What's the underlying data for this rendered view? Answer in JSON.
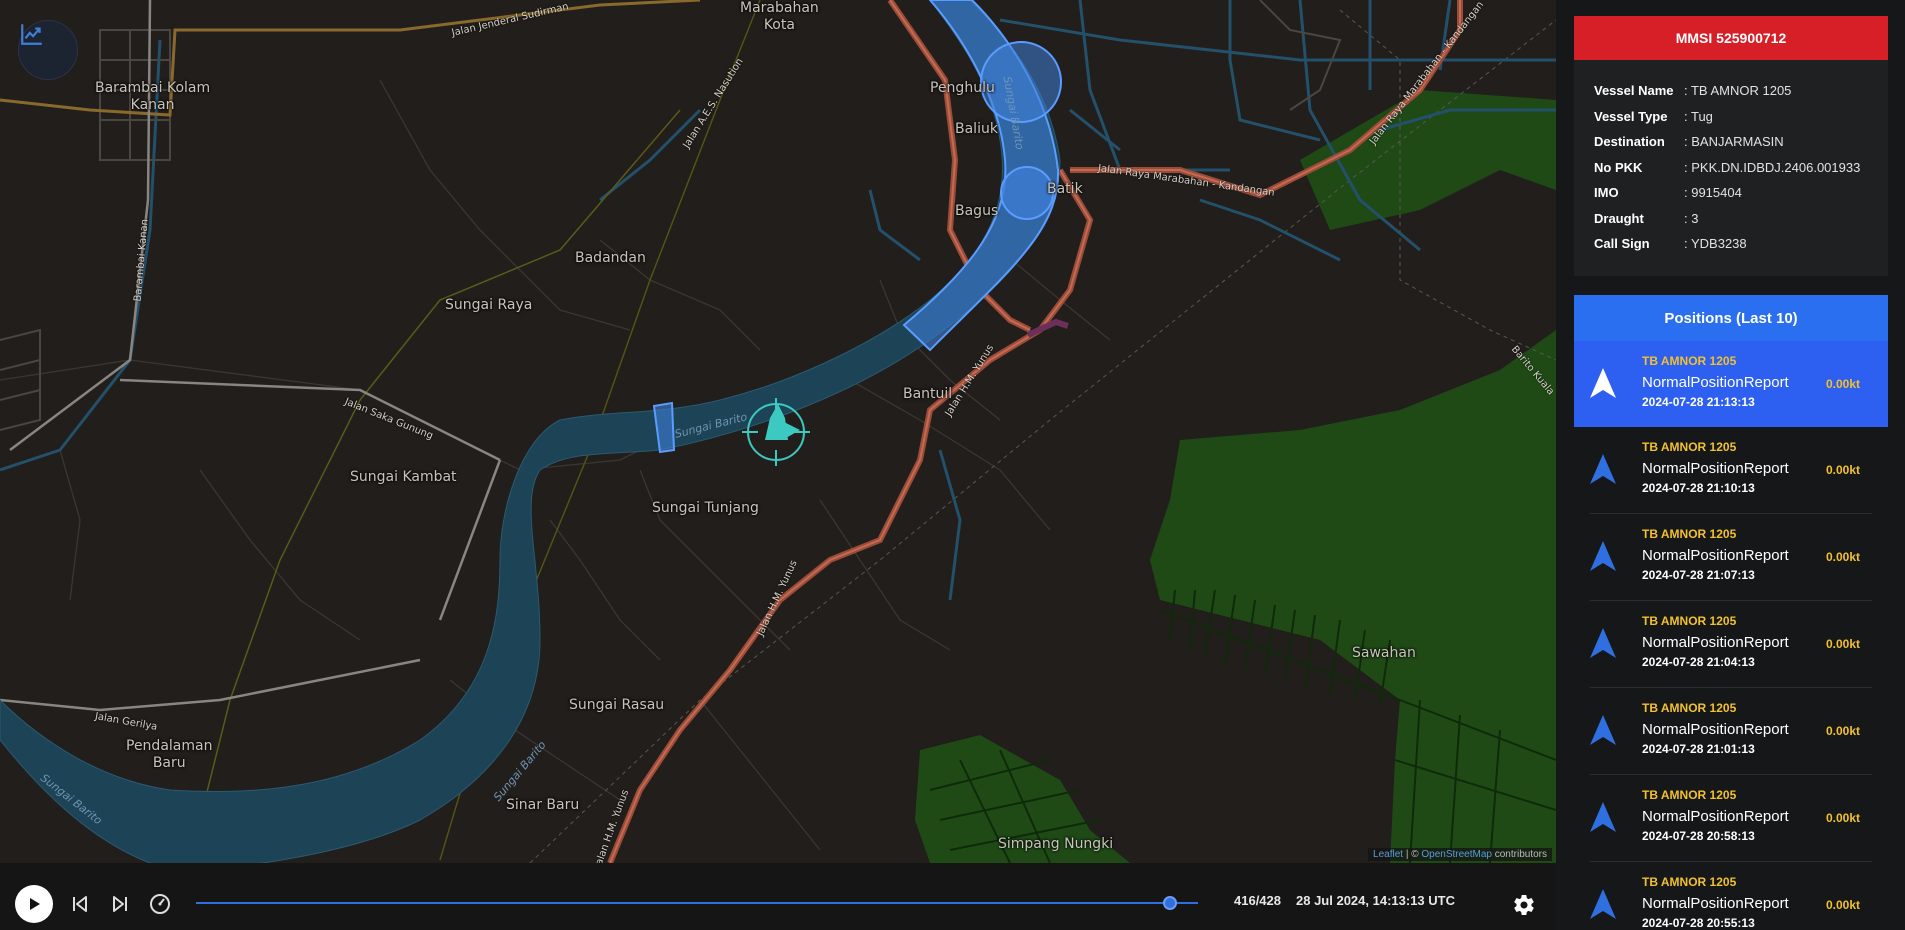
{
  "map": {
    "places": [
      {
        "id": "marabahan-kota",
        "text": "Marabahan\nKota"
      },
      {
        "id": "barambai-kolam-kanan",
        "text": "Barambai Kolam\nKanan"
      },
      {
        "id": "penghulu",
        "text": "Penghulu"
      },
      {
        "id": "baliuk",
        "text": "Baliuk"
      },
      {
        "id": "bagus",
        "text": "Bagus"
      },
      {
        "id": "batik",
        "text": "Batik"
      },
      {
        "id": "badandan",
        "text": "Badandan"
      },
      {
        "id": "sungai-raya",
        "text": "Sungai Raya"
      },
      {
        "id": "bantuil",
        "text": "Bantuil"
      },
      {
        "id": "sungai-kambat",
        "text": "Sungai Kambat"
      },
      {
        "id": "sungai-tunjang",
        "text": "Sungai Tunjang"
      },
      {
        "id": "sawahan",
        "text": "Sawahan"
      },
      {
        "id": "sungai-rasau",
        "text": "Sungai Rasau"
      },
      {
        "id": "pendalaman-baru",
        "text": "Pendalaman\nBaru"
      },
      {
        "id": "sinar-baru",
        "text": "Sinar Baru"
      },
      {
        "id": "simpang-nungki",
        "text": "Simpang Nungki"
      }
    ],
    "road_labels": {
      "jalan_sudirman": "Jalan Jenderal Sudirman",
      "jalan_nasution": "Jalan A.E.S. Nasution",
      "jalan_marabahan_1": "Jalan Raya Marabahan - Kandangan",
      "jalan_marabahan_2": "Jalan Raya Marabahan - Kandangan",
      "jalan_yunus_1": "Jalan H.M. Yunus",
      "jalan_yunus_2": "Jalan H.M. Yunus",
      "jalan_yunus_3": "Jalan H.M. Yunus",
      "jalan_saka_gunung": "Jalan Saka Gunung",
      "jalan_gerilya": "Jalan Gerilya",
      "jalan_bantil": "Barambai Kanan",
      "barito_kuala": "Barito Kuala"
    },
    "river_labels": {
      "barito_1": "Sungai Barito",
      "barito_2": "Sungai Barito",
      "barito_3": "Sungai Barito",
      "barito_4": "Sungai Barito"
    },
    "attribution": {
      "leaflet": "Leaflet",
      "separator": " | © ",
      "osm": "OpenStreetMap",
      "suffix": " contributors"
    },
    "chart_icon": "chart-line-icon",
    "colors": {
      "river": "#1d4356",
      "zone": "#3f7fd8",
      "vessel": "#3bc9c2",
      "forest": "#1d4a14",
      "road_main": "#b95c45"
    }
  },
  "playback": {
    "counter": "416/428",
    "timestamp": "28 Jul 2024, 14:13:13 UTC",
    "progress": 0.972,
    "icons": {
      "play": "play-icon",
      "prev": "skip-back-icon",
      "next": "skip-forward-icon",
      "speed": "speedometer-icon",
      "settings": "gear-icon"
    }
  },
  "vessel": {
    "mmsi_title": "MMSI 525900712",
    "fields": [
      {
        "key": "Vessel Name",
        "value": ": TB AMNOR 1205"
      },
      {
        "key": "Vessel Type",
        "value": ": Tug"
      },
      {
        "key": "Destination",
        "value": ": BANJARMASIN"
      },
      {
        "key": "No PKK",
        "value": ": PKK.DN.IDBDJ.2406.001933"
      },
      {
        "key": "IMO",
        "value": ": 9915404"
      },
      {
        "key": "Draught",
        "value": ": 3"
      },
      {
        "key": "Call Sign",
        "value": ": YDB3238"
      }
    ]
  },
  "positions": {
    "title": "Positions (Last 10)",
    "items": [
      {
        "name": "TB AMNOR 1205",
        "type": "NormalPositionReport",
        "time": "2024-07-28 21:13:13",
        "speed": "0.00kt"
      },
      {
        "name": "TB AMNOR 1205",
        "type": "NormalPositionReport",
        "time": "2024-07-28 21:10:13",
        "speed": "0.00kt"
      },
      {
        "name": "TB AMNOR 1205",
        "type": "NormalPositionReport",
        "time": "2024-07-28 21:07:13",
        "speed": "0.00kt"
      },
      {
        "name": "TB AMNOR 1205",
        "type": "NormalPositionReport",
        "time": "2024-07-28 21:04:13",
        "speed": "0.00kt"
      },
      {
        "name": "TB AMNOR 1205",
        "type": "NormalPositionReport",
        "time": "2024-07-28 21:01:13",
        "speed": "0.00kt"
      },
      {
        "name": "TB AMNOR 1205",
        "type": "NormalPositionReport",
        "time": "2024-07-28 20:58:13",
        "speed": "0.00kt"
      },
      {
        "name": "TB AMNOR 1205",
        "type": "NormalPositionReport",
        "time": "2024-07-28 20:55:13",
        "speed": "0.00kt"
      }
    ]
  }
}
